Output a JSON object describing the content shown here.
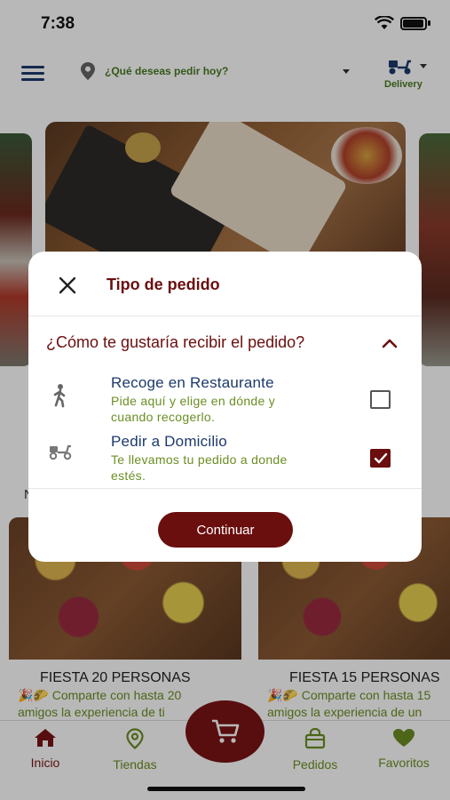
{
  "status_bar": {
    "time": "7:38"
  },
  "header": {
    "location_prompt": "¿Qué deseas pedir hoy?",
    "delivery_label": "Delivery"
  },
  "background": {
    "section_letter": "N",
    "cards": [
      {
        "title": "FIESTA 20 PERSONAS",
        "desc_line1": "🎉🌮 Comparte con hasta 20",
        "desc_line2": "amigos la experiencia de ti"
      },
      {
        "title": "FIESTA 15 PERSONAS",
        "desc_line1": "🎉🌮 Comparte con hasta 15",
        "desc_line2": "amigos la experiencia de un"
      }
    ]
  },
  "modal": {
    "title": "Tipo de pedido",
    "question": "¿Cómo te gustaría recibir el pedido?",
    "options": [
      {
        "title": "Recoge en Restaurante",
        "description": "Pide aquí y elige en dónde y cuando recogerlo.",
        "icon": "walking-person-icon",
        "checked": false
      },
      {
        "title": "Pedir a Domicilio",
        "description": "Te llevamos tu pedido a donde estés.",
        "icon": "scooter-icon",
        "checked": true
      }
    ],
    "continue_label": "Continuar"
  },
  "tabbar": {
    "items": [
      {
        "label": "Inicio",
        "icon": "home-icon",
        "active": true
      },
      {
        "label": "Tiendas",
        "icon": "map-pin-icon",
        "active": false
      },
      {
        "label": "Pedidos",
        "icon": "bag-icon",
        "active": false
      },
      {
        "label": "Favoritos",
        "icon": "heart-icon",
        "active": false
      }
    ],
    "cart_icon": "cart-icon"
  },
  "colors": {
    "brand": "#6b0e0e",
    "accent_green": "#6b8e23",
    "option_title": "#1d3a6b"
  }
}
